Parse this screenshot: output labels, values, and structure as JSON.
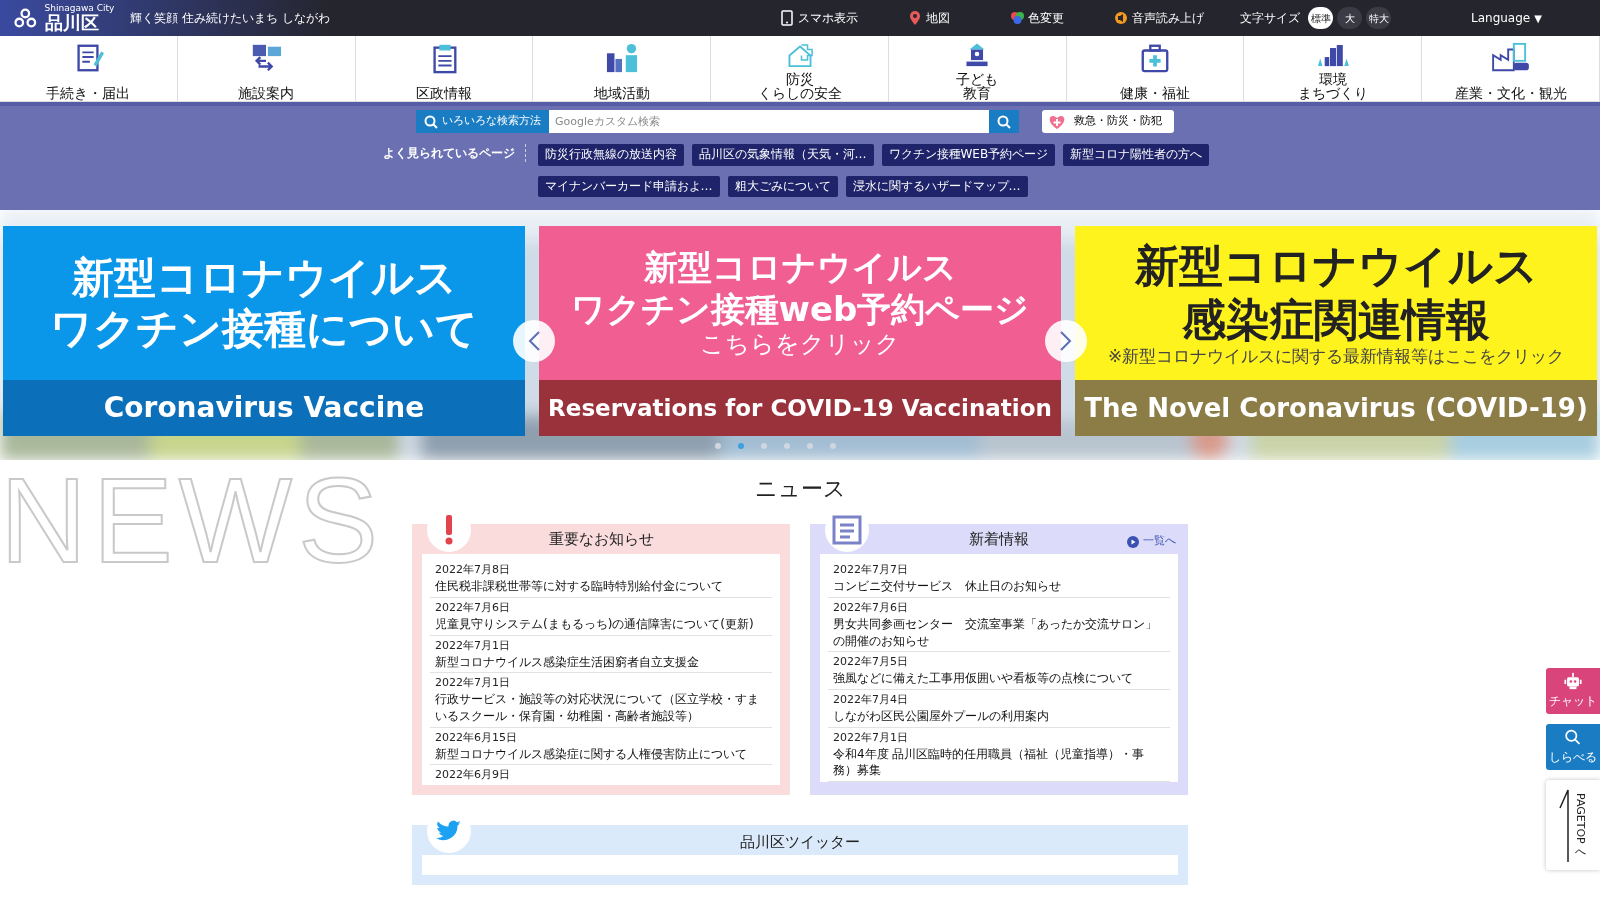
{
  "header": {
    "logo_small": "Shinagawa City",
    "logo": "品川区",
    "tagline": "輝く笑顔 住み続けたいまち しながわ",
    "tools": [
      {
        "label": "スマホ表示"
      },
      {
        "label": "地図"
      },
      {
        "label": "色変更"
      },
      {
        "label": "音声読み上げ"
      }
    ],
    "text_size": {
      "label": "文字サイズ",
      "options": [
        {
          "label": "標準",
          "selected": true
        },
        {
          "label": "大",
          "selected": false
        },
        {
          "label": "特大",
          "selected": false
        }
      ]
    },
    "language": "Language",
    "language_caret": "▼"
  },
  "nav": [
    {
      "lines": [
        "手続き・届出"
      ]
    },
    {
      "lines": [
        "施設案内"
      ]
    },
    {
      "lines": [
        "区政情報"
      ]
    },
    {
      "lines": [
        "地域活動"
      ]
    },
    {
      "lines": [
        "防災",
        "くらしの安全"
      ]
    },
    {
      "lines": [
        "子ども",
        "教育"
      ]
    },
    {
      "lines": [
        "健康・福祉"
      ]
    },
    {
      "lines": [
        "環境",
        "まちづくり"
      ]
    },
    {
      "lines": [
        "産業・文化・観光"
      ]
    }
  ],
  "search": {
    "method_button": "いろいろな検索方法",
    "placeholder": "Googleカスタム検索"
  },
  "emergency": "救急・防災・防犯",
  "popular": {
    "label": "よく見られているページ",
    "links": [
      "防災行政無線の放送内容",
      "品川区の気象情報（天気・河…",
      "ワクチン接種WEB予約ページ",
      "新型コロナ陽性者の方へ",
      "マイナンバーカード申請およ…",
      "粗大ごみについて",
      "浸水に関するハザードマップ…"
    ]
  },
  "carousel": {
    "slides": [
      {
        "title_lines": [
          "新型コロナウイルス",
          "ワクチン接種について"
        ],
        "caption": "Coronavirus Vaccine"
      },
      {
        "title_lines": [
          "新型コロナウイルス",
          "ワクチン接種web予約ページ"
        ],
        "subtitle": "こちらをクリック",
        "caption": "Reservations for COVID-19 Vaccination"
      },
      {
        "title_lines": [
          "新型コロナウイルス",
          "感染症関連情報"
        ],
        "subtitle": "※新型コロナウイルスに関する最新情報等はここをクリック",
        "caption": "The Novel Coronavirus (COVID-19)"
      }
    ],
    "dots": [
      {
        "selected": false
      },
      {
        "selected": true
      },
      {
        "selected": false
      },
      {
        "selected": false
      },
      {
        "selected": false
      },
      {
        "selected": false
      }
    ]
  },
  "news": {
    "watermark": "NEWS",
    "title": "ニュース",
    "panels": [
      {
        "title": "重要なお知らせ",
        "items": [
          {
            "date": "2022年7月8日",
            "text": "住民税非課税世帯等に対する臨時特別給付金について"
          },
          {
            "date": "2022年7月6日",
            "text": "児童見守りシステム(まもるっち)の通信障害について(更新)"
          },
          {
            "date": "2022年7月1日",
            "text": "新型コロナウイルス感染症生活困窮者自立支援金"
          },
          {
            "date": "2022年7月1日",
            "text": "行政サービス・施設等の対応状況について（区立学校・すまいるスクール・保育園・幼稚園・高齢者施設等）"
          },
          {
            "date": "2022年6月15日",
            "text": "新型コロナウイルス感染症に関する人権侵害防止について"
          },
          {
            "date": "2022年6月9日"
          }
        ]
      },
      {
        "title": "新着情報",
        "more_link": "一覧へ",
        "items": [
          {
            "date": "2022年7月7日",
            "text": "コンビニ交付サービス　休止日のお知らせ"
          },
          {
            "date": "2022年7月6日",
            "text": "男女共同参画センター　交流室事業「あったか交流サロン」の開催のお知らせ"
          },
          {
            "date": "2022年7月5日",
            "text": "強風などに備えた工事用仮囲いや看板等の点検について"
          },
          {
            "date": "2022年7月4日",
            "text": "しながわ区民公園屋外プールの利用案内"
          },
          {
            "date": "2022年7月1日",
            "text": "令和4年度 品川区臨時的任用職員（福祉（児童指導）・事務）募集"
          }
        ]
      }
    ]
  },
  "twitter": {
    "title": "品川区ツイッター"
  },
  "side_buttons": [
    {
      "label": "チャット"
    },
    {
      "label": "しらべる"
    },
    {
      "label": "PAGETOPへ"
    }
  ]
}
